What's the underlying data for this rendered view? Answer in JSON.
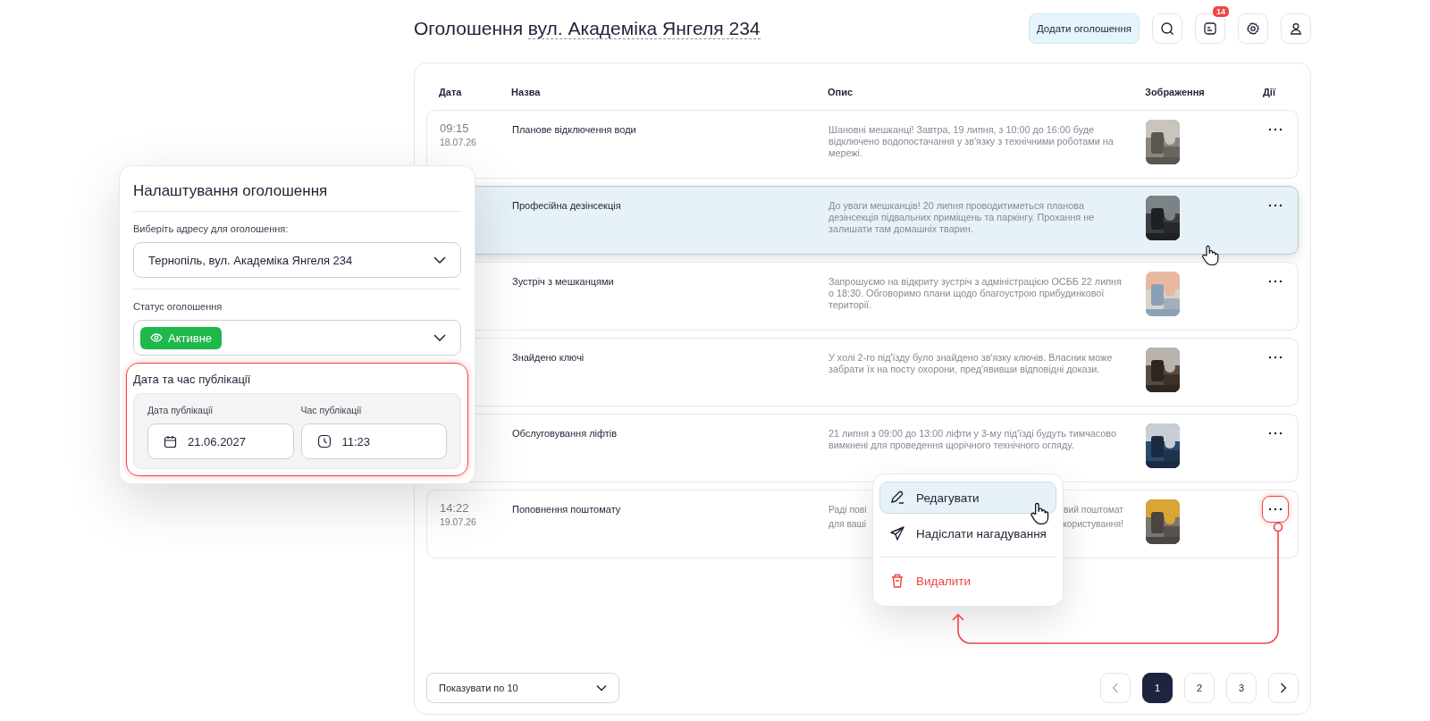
{
  "header": {
    "title": "Оголошення",
    "address": "вул. Академіка Янгеля 234",
    "add_button": "Додати оголошення",
    "notifications_badge": "14"
  },
  "table": {
    "columns": [
      "Дата",
      "Назва",
      "Опис",
      "Зображення",
      "Дії"
    ],
    "rows": [
      {
        "time": "09:15",
        "date": "18.07.26",
        "title": "Планове відключення води",
        "description": "Шановні мешканці! Завтра, 19 липня, з 10:00 до 16:00 буде відключено водопостачання у зв'язку з технічними роботами на мережі.",
        "image": {
          "kind": "picture"
        },
        "highlighted": false,
        "menu_open": false
      },
      {
        "title": "Професійна дезінсекція",
        "description": "До уваги мешканців! 20 липня проводитиметься планова дезінсекція підвальних приміщень та паркінгу. Прохання не залишати там домашніх тварин.",
        "image": {
          "kind": "picture"
        },
        "highlighted": true,
        "menu_open": false
      },
      {
        "title": "Зустріч з мешканцями",
        "description": "Запрошуємо на відкриту зустріч з адміністрацією ОСББ 22 липня о 18:30. Обговоримо плани щодо благоустрою прибудинкової території.",
        "image": {
          "kind": "picture"
        },
        "highlighted": false,
        "menu_open": false
      },
      {
        "title": "Знайдено ключі",
        "description": "У холі 2-го під'їзду було знайдено зв'язку ключів. Власник може забрати їх на посту охорони, пред'явивши відповідні докази.",
        "image": {
          "kind": "picture"
        },
        "highlighted": false,
        "menu_open": false
      },
      {
        "title": "Обслуговування ліфтів",
        "description": "21 липня з 09:00 до 13:00 ліфти у 3-му під'їзді будуть тимчасово вимкнені для проведення щорічного технічного огляду.",
        "image": {
          "kind": "picture"
        },
        "highlighted": false,
        "menu_open": false
      },
      {
        "time": "14:22",
        "date": "19.07.26",
        "title": "Поповнення поштомату",
        "description_fragments": [
          "Раді пові",
          "вий поштомат",
          "для ваші",
          "користування!"
        ],
        "image": {
          "kind": "picture"
        },
        "highlighted": false,
        "menu_open": true
      }
    ]
  },
  "pagination": {
    "page_size": "Показувати по 10",
    "pages": [
      {
        "label": "1",
        "selected": true
      },
      {
        "label": "2",
        "selected": false
      },
      {
        "label": "3",
        "selected": false
      }
    ]
  },
  "settings_panel": {
    "title": "Налаштування оголошення",
    "address_label": "Виберіть адресу для оголошення:",
    "address_value": "Тернопіль, вул. Академіка Янгеля 234",
    "status_label": "Статус оголошення",
    "status": {
      "label": "Активне",
      "kind": "active"
    },
    "publication": {
      "heading": "Дата та час публікації",
      "highlighted": true,
      "date_label": "Дата публікації",
      "date_value": "21.06.2027",
      "time_label": "Час публікації",
      "time_value": "11:23"
    }
  },
  "actions_menu": {
    "items": [
      {
        "label": "Редагувати",
        "kind": "edit",
        "selected": true
      },
      {
        "label": "Надіслати нагадування",
        "kind": "send",
        "selected": false
      },
      {
        "label": "Видалити",
        "kind": "delete",
        "selected": false
      }
    ]
  }
}
